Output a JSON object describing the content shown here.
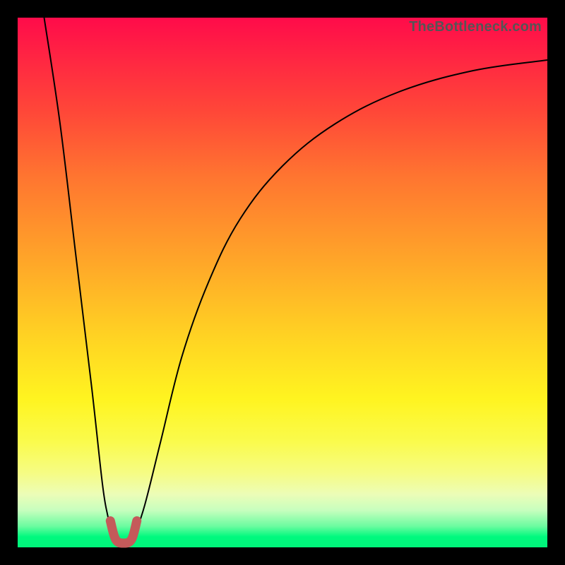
{
  "attribution": "TheBottleneck.com",
  "chart_data": {
    "type": "line",
    "title": "",
    "xlabel": "",
    "ylabel": "",
    "xlim": [
      0,
      100
    ],
    "ylim": [
      0,
      100
    ],
    "series": [
      {
        "name": "curve-left",
        "x": [
          5,
          8,
          11,
          14,
          16,
          17,
          18
        ],
        "y": [
          100,
          80,
          55,
          30,
          12,
          6,
          2
        ]
      },
      {
        "name": "curve-right",
        "x": [
          22,
          24,
          27,
          31,
          36,
          42,
          50,
          60,
          72,
          86,
          100
        ],
        "y": [
          2,
          8,
          20,
          36,
          50,
          62,
          72,
          80,
          86,
          90,
          92
        ]
      },
      {
        "name": "valley-marker",
        "x": [
          17.5,
          18.5,
          20,
          21.5,
          22.5
        ],
        "y": [
          5,
          1.5,
          0.8,
          1.5,
          5
        ]
      }
    ],
    "colors": {
      "curve": "#000000",
      "marker": "#c45a5a"
    }
  }
}
